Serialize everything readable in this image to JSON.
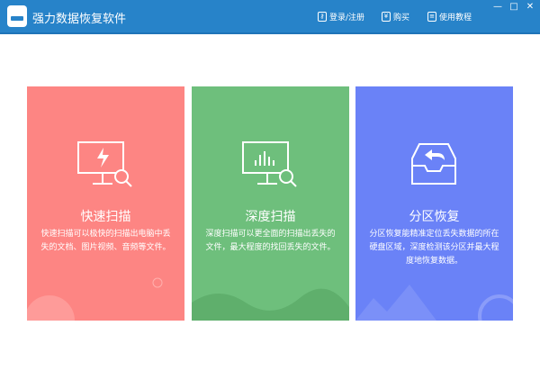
{
  "app": {
    "title": "强力数据恢复软件"
  },
  "toolbar": {
    "login": "登录/注册",
    "buy": "购买",
    "tutorial": "使用教程",
    "minimize": "—",
    "maximize": "□",
    "close": "✕"
  },
  "cards": [
    {
      "title": "快速扫描",
      "desc": "快速扫描可以极快的扫描出电脑中丢失的文档、图片视频、音频等文件。"
    },
    {
      "title": "深度扫描",
      "desc": "深度扫描可以更全面的扫描出丢失的文件，最大程度的找回丢失的文件。"
    },
    {
      "title": "分区恢复",
      "desc": "分区恢复能精准定位丢失数据的所在硬盘区域，深度检测该分区并最大程度地恢复数据。"
    }
  ]
}
